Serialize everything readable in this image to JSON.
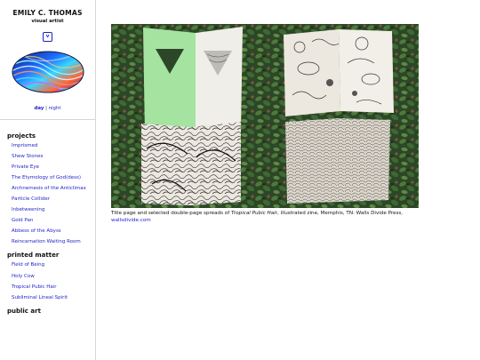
{
  "site": {
    "name": "EMILY C. THOMAS",
    "tagline": "visual artist",
    "menu_glyph": "v"
  },
  "mode": {
    "day": "day",
    "separator": "|",
    "night": "night"
  },
  "sections": [
    {
      "title": "projects",
      "items": [
        "Imprismed",
        "Shew Stones",
        "Private Eye",
        "The Etymology of God(dess)",
        "Archnemesis of the Anticlimax",
        "Particle Collider",
        "Inbetweening",
        "Gold Pan",
        "Abbess of the Abyss",
        "Reincarnation Waiting Room"
      ]
    },
    {
      "title": "printed matter",
      "items": [
        "Field of Being",
        "Holy Cow",
        "Tropical Pubic Hair",
        "Subliminal Lineal Spirit"
      ]
    },
    {
      "title": "public art",
      "items": []
    }
  ],
  "caption": {
    "before": "Title page and selected double-page spreads of ",
    "italic": "Tropical Pubic Hair",
    "after": ", illustrated zine, Memphis, TN: Walls Divide Press, ",
    "link": "wallsdivide.com"
  },
  "colors": {
    "link": "#1e1ec8",
    "grass": "#2e4a2a",
    "zine_green": "#a4e4a0",
    "paper": "#ece8e0"
  }
}
